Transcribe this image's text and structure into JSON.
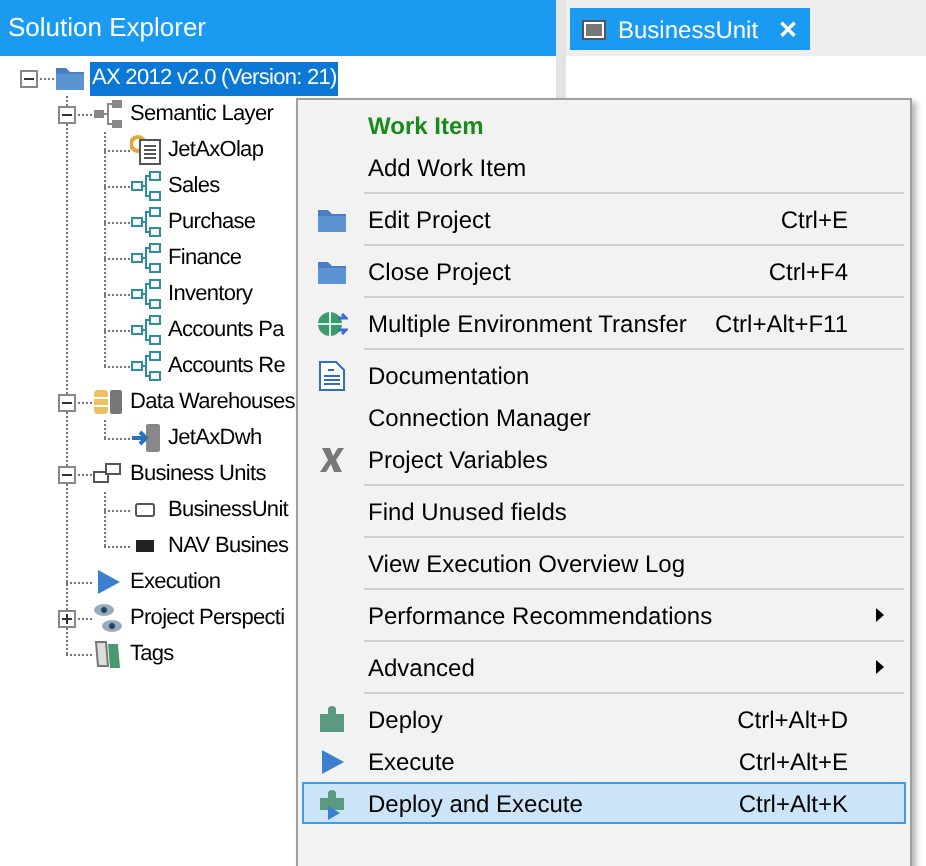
{
  "solution_explorer": {
    "title": "Solution Explorer",
    "tree": [
      {
        "label": "AX 2012 v2.0 (Version: 21)",
        "kind": "folder",
        "expanded": true,
        "selected": true,
        "children": [
          {
            "label": "Semantic Layer",
            "kind": "hierarchy",
            "expanded": true,
            "selected": false,
            "children": [
              {
                "label": "JetAxOlap",
                "kind": "cube-doc",
                "selected": false
              },
              {
                "label": "Sales",
                "kind": "perspective",
                "selected": false
              },
              {
                "label": "Purchase",
                "kind": "perspective",
                "selected": false
              },
              {
                "label": "Finance",
                "kind": "perspective",
                "selected": false
              },
              {
                "label": "Inventory",
                "kind": "perspective",
                "selected": false
              },
              {
                "label": "Accounts Pa",
                "kind": "perspective",
                "selected": false
              },
              {
                "label": "Accounts Re",
                "kind": "perspective",
                "selected": false
              }
            ]
          },
          {
            "label": "Data Warehouses",
            "kind": "warehouse",
            "expanded": true,
            "selected": false,
            "children": [
              {
                "label": "JetAxDwh",
                "kind": "dwh",
                "selected": false
              }
            ]
          },
          {
            "label": "Business Units",
            "kind": "units",
            "expanded": true,
            "selected": false,
            "children": [
              {
                "label": "BusinessUnit",
                "kind": "unit",
                "selected": false
              },
              {
                "label": "NAV Busines",
                "kind": "unit-dark",
                "selected": false
              }
            ]
          },
          {
            "label": "Execution",
            "kind": "play",
            "selected": false
          },
          {
            "label": "Project Perspecti",
            "kind": "eyes",
            "expanded": false,
            "selected": false
          },
          {
            "label": "Tags",
            "kind": "tags",
            "selected": false
          }
        ]
      }
    ]
  },
  "tab": {
    "label": "BusinessUnit",
    "close": "✕"
  },
  "context_menu": {
    "groups": [
      [
        {
          "kind": "header",
          "label": "Work Item",
          "selected": false
        },
        {
          "kind": "plain",
          "label": "Add Work Item",
          "selected": false
        }
      ],
      [
        {
          "kind": "folder",
          "label": "Edit Project",
          "shortcut": "Ctrl+E",
          "selected": false
        }
      ],
      [
        {
          "kind": "folder",
          "label": "Close Project",
          "shortcut": "Ctrl+F4",
          "selected": false
        }
      ],
      [
        {
          "kind": "globe",
          "label": "Multiple Environment Transfer",
          "shortcut": "Ctrl+Alt+F11",
          "selected": false
        }
      ],
      [
        {
          "kind": "document",
          "label": "Documentation",
          "selected": false
        },
        {
          "kind": "plain",
          "label": "Connection Manager",
          "selected": false
        },
        {
          "kind": "variable",
          "label": "Project Variables",
          "selected": false
        }
      ],
      [
        {
          "kind": "plain",
          "label": "Find Unused fields",
          "selected": false
        }
      ],
      [
        {
          "kind": "plain",
          "label": "View Execution Overview Log",
          "selected": false
        }
      ],
      [
        {
          "kind": "submenu",
          "label": "Performance Recommendations",
          "selected": false
        }
      ],
      [
        {
          "kind": "submenu",
          "label": "Advanced",
          "selected": false
        }
      ],
      [
        {
          "kind": "puzzle",
          "label": "Deploy",
          "shortcut": "Ctrl+Alt+D",
          "selected": false
        },
        {
          "kind": "play",
          "label": "Execute",
          "shortcut": "Ctrl+Alt+E",
          "selected": false
        },
        {
          "kind": "puzzle-play",
          "label": "Deploy and Execute",
          "shortcut": "Ctrl+Alt+K",
          "selected": true
        }
      ]
    ]
  }
}
